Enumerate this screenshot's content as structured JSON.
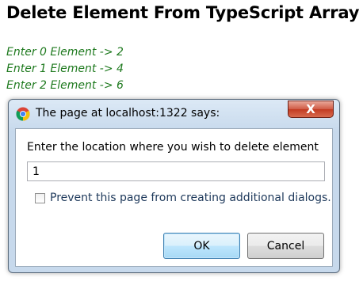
{
  "page": {
    "title": "Delete Element From TypeScript Array",
    "log_lines": [
      "Enter 0 Element -> 2",
      "Enter 1 Element -> 4",
      "Enter 2 Element -> 6"
    ]
  },
  "dialog": {
    "title": "The page at localhost:1322 says:",
    "close_label": "X",
    "message": "Enter the location where you wish to delete element",
    "input_value": "1",
    "checkbox_label": "Prevent this page from creating additional dialogs.",
    "ok_label": "OK",
    "cancel_label": "Cancel",
    "icon": "chrome-icon"
  }
}
